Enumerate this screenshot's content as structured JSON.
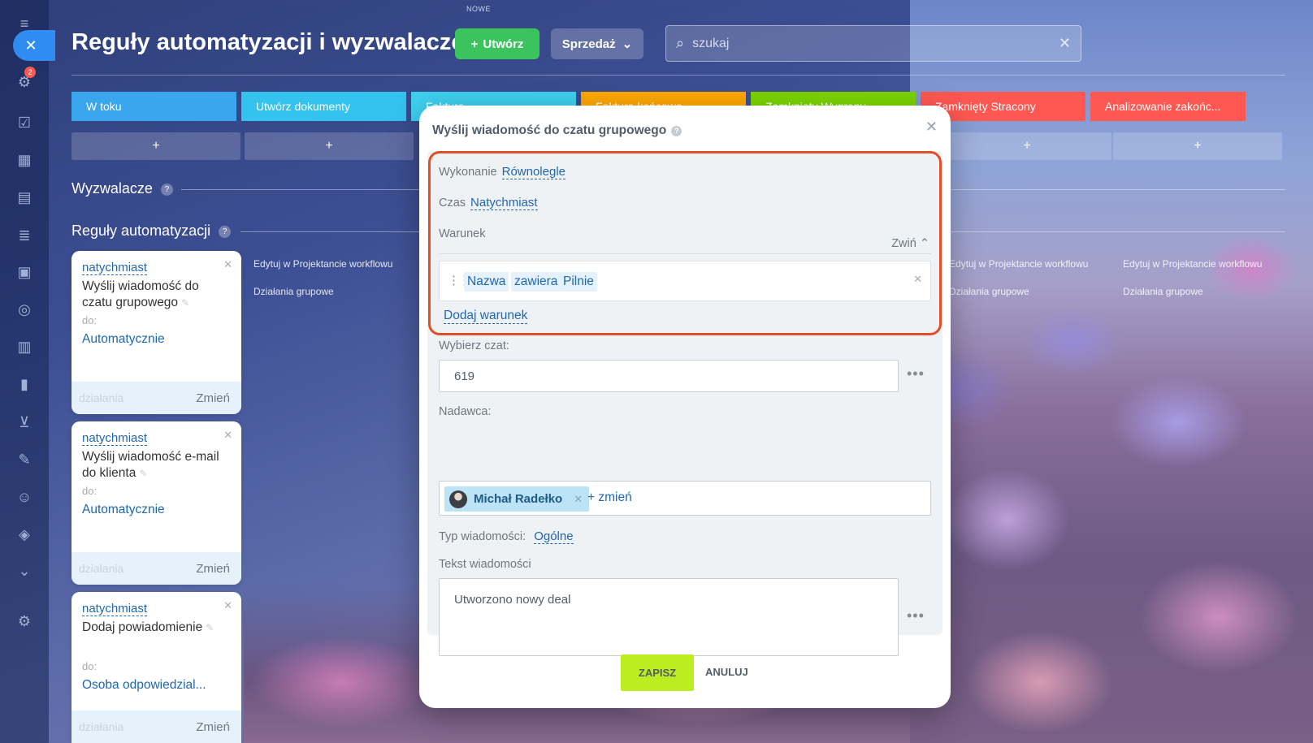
{
  "top_hint": "NOWE",
  "rail": {
    "notifications_count": "2"
  },
  "header": {
    "title": "Reguły automatyzacji i wyzwalacze",
    "create_label": "Utwórz",
    "sales_label": "Sprzedaż",
    "search_placeholder": "szukaj"
  },
  "stages": [
    {
      "label": "W toku",
      "color": "#3aa6ee"
    },
    {
      "label": "Utwórz dokumenty",
      "color": "#33c3ee"
    },
    {
      "label": "Faktura",
      "color": "#3ed0f0"
    },
    {
      "label": "Faktura końcowa",
      "color": "#ffa900"
    },
    {
      "label": "Zamknięty Wygrany",
      "color": "#7bd500"
    },
    {
      "label": "Zamknięty Stracony",
      "color": "#ff5752"
    },
    {
      "label": "Analizowanie zakońc...",
      "color": "#ff5752"
    }
  ],
  "add_label": "+",
  "sections": {
    "triggers": "Wyzwalacze",
    "rules": "Reguły automatyzacji"
  },
  "column_links": {
    "edit": "Edytuj w Projektancie workflowu",
    "group": "Działania grupowe"
  },
  "cards": [
    {
      "time": "natychmiast",
      "title": "Wyślij wiadomość do czatu grupowego",
      "to_label": "do:",
      "responsible": "Automatycznie",
      "actions": "działania",
      "change": "Zmień"
    },
    {
      "time": "natychmiast",
      "title": "Wyślij wiadomość e-mail do klienta",
      "to_label": "do:",
      "responsible": "Automatycznie",
      "actions": "działania",
      "change": "Zmień"
    },
    {
      "time": "natychmiast",
      "title": "Dodaj powiadomienie",
      "to_label": "do:",
      "responsible": "Osoba odpowiedzial...",
      "actions": "działania",
      "change": "Zmień"
    }
  ],
  "modal": {
    "title": "Wyślij wiadomość do czatu grupowego",
    "execution_label": "Wykonanie",
    "execution_value": "Równolegle",
    "time_label": "Czas",
    "time_value": "Natychmiast",
    "condition_label": "Warunek",
    "collapse_label": "Zwiń",
    "condition": {
      "field": "Nazwa",
      "operator": "zawiera",
      "value": "Pilnie"
    },
    "add_condition": "Dodaj warunek",
    "chat_label": "Wybierz czat:",
    "chat_value": "619",
    "sender_label": "Nadawca:",
    "sender_name": "Michał Radełko",
    "sender_change": "+ zmień",
    "type_label": "Typ wiadomości:",
    "type_value": "Ogólne",
    "text_label": "Tekst wiadomości",
    "text_value": "Utworzono nowy deal",
    "save": "ZAPISZ",
    "cancel": "ANULUJ"
  },
  "colors": {
    "accent_blue": "#2067b0",
    "create_green": "#3bc35e",
    "save_lime": "#bbed21",
    "highlight_red": "#e24e2a"
  }
}
